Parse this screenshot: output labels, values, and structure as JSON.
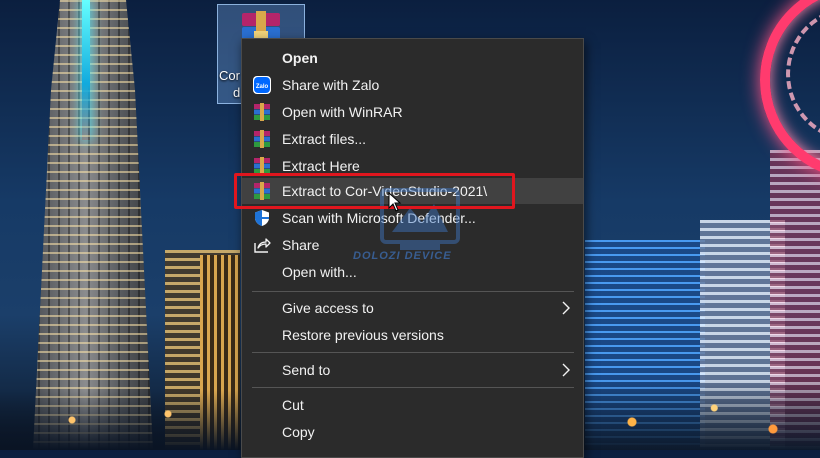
{
  "desktop_icon": {
    "label_line1": "Cor",
    "label_line2": "d",
    "icon": "winrar-archive-icon"
  },
  "context_menu": {
    "items": [
      {
        "label": "Open",
        "icon": "",
        "bold": true
      },
      {
        "label": "Share with Zalo",
        "icon": "zalo-icon"
      },
      {
        "label": "Open with WinRAR",
        "icon": "winrar-icon"
      },
      {
        "label": "Extract files...",
        "icon": "winrar-icon"
      },
      {
        "label": "Extract Here",
        "icon": "winrar-icon"
      },
      {
        "label": "Extract to Cor-VideoStudio-2021\\",
        "icon": "winrar-icon",
        "highlighted": true
      },
      {
        "label": "Scan with Microsoft Defender...",
        "icon": "defender-shield-icon"
      },
      {
        "label": "Share",
        "icon": "share-icon"
      },
      {
        "label": "Open with...",
        "icon": ""
      },
      {
        "label": "Give access to",
        "icon": "",
        "submenu": true
      },
      {
        "label": "Restore previous versions",
        "icon": ""
      },
      {
        "label": "Send to",
        "icon": "",
        "submenu": true
      },
      {
        "label": "Cut",
        "icon": ""
      },
      {
        "label": "Copy",
        "icon": ""
      }
    ]
  },
  "watermark": {
    "text": "DOLOZI DEVICE"
  },
  "colors": {
    "menu_bg": "#2b2b2b",
    "menu_text": "#f2f2f2",
    "hover_bg": "#414141",
    "highlight_box": "#e0161e"
  }
}
